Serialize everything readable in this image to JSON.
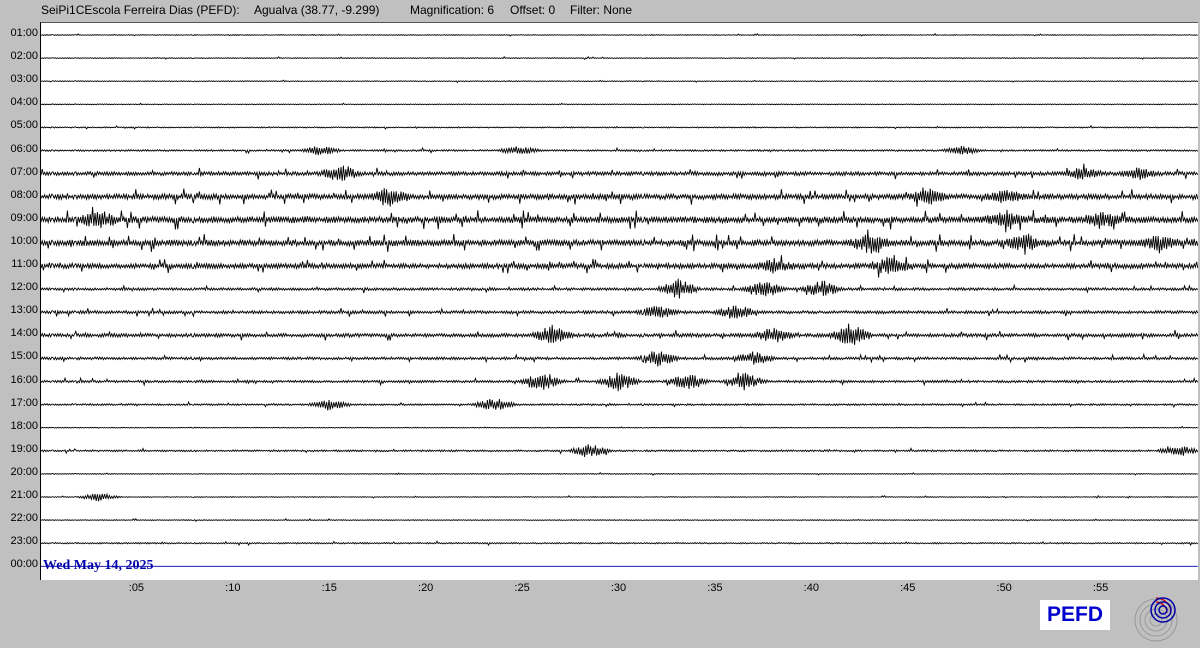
{
  "header": {
    "station": "SeiPi1CEscola Ferreira Dias (PEFD):",
    "location": "Agualva (38.77, -9.299)",
    "magnification": "Magnification: 6",
    "offset": "Offset: 0",
    "filter": "Filter: None"
  },
  "chart_data": {
    "type": "helicorder",
    "date_label": "Wed May 14, 2025",
    "hour_labels": [
      "01:00",
      "02:00",
      "03:00",
      "04:00",
      "05:00",
      "06:00",
      "07:00",
      "08:00",
      "09:00",
      "10:00",
      "11:00",
      "12:00",
      "13:00",
      "14:00",
      "15:00",
      "16:00",
      "17:00",
      "18:00",
      "19:00",
      "20:00",
      "21:00",
      "22:00",
      "23:00",
      "00:00"
    ],
    "minute_labels": [
      ":05",
      ":10",
      ":15",
      ":20",
      ":25",
      ":30",
      ":35",
      ":40",
      ":45",
      ":50",
      ":55"
    ],
    "x_range_minutes": [
      0,
      60
    ],
    "current_trace_color": "#0000aa",
    "trace_color": "#000000",
    "activity": [
      {
        "hour": "01:00",
        "level": 0.3
      },
      {
        "hour": "02:00",
        "level": 0.3
      },
      {
        "hour": "03:00",
        "level": 0.3
      },
      {
        "hour": "04:00",
        "level": 0.3
      },
      {
        "hour": "05:00",
        "level": 0.4
      },
      {
        "hour": "06:00",
        "level": 0.6,
        "bursts": [
          [
            14.5,
            4
          ],
          [
            24.8,
            3
          ],
          [
            47.8,
            3
          ]
        ]
      },
      {
        "hour": "07:00",
        "level": 1.3,
        "bursts": [
          [
            15.5,
            6
          ],
          [
            54,
            4
          ],
          [
            57,
            4
          ]
        ]
      },
      {
        "hour": "08:00",
        "level": 1.8,
        "bursts": [
          [
            18,
            5
          ],
          [
            46,
            5
          ],
          [
            50,
            4
          ]
        ]
      },
      {
        "hour": "09:00",
        "level": 2.2,
        "bursts": [
          [
            3,
            6
          ],
          [
            50,
            5
          ],
          [
            55,
            5
          ]
        ]
      },
      {
        "hour": "10:00",
        "level": 2.0,
        "bursts": [
          [
            43,
            7
          ],
          [
            51,
            6
          ],
          [
            58,
            5
          ]
        ]
      },
      {
        "hour": "11:00",
        "level": 1.7,
        "bursts": [
          [
            44,
            6
          ],
          [
            38,
            5
          ]
        ]
      },
      {
        "hour": "12:00",
        "level": 0.9,
        "bursts": [
          [
            33,
            7
          ],
          [
            37.5,
            6
          ],
          [
            40.5,
            6
          ]
        ]
      },
      {
        "hour": "13:00",
        "level": 1.0,
        "bursts": [
          [
            32,
            5
          ],
          [
            36,
            6
          ]
        ]
      },
      {
        "hour": "14:00",
        "level": 1.2,
        "bursts": [
          [
            26.5,
            7
          ],
          [
            42,
            8
          ],
          [
            38,
            5
          ]
        ]
      },
      {
        "hour": "15:00",
        "level": 0.9,
        "bursts": [
          [
            32,
            6
          ],
          [
            37,
            5
          ]
        ]
      },
      {
        "hour": "16:00",
        "level": 0.8,
        "bursts": [
          [
            26,
            7
          ],
          [
            30,
            7
          ],
          [
            33.5,
            6
          ],
          [
            36.5,
            6
          ]
        ]
      },
      {
        "hour": "17:00",
        "level": 0.6,
        "bursts": [
          [
            15,
            4
          ],
          [
            23.5,
            5
          ]
        ]
      },
      {
        "hour": "18:00",
        "level": 0.3
      },
      {
        "hour": "19:00",
        "level": 0.6,
        "bursts": [
          [
            28.5,
            5
          ],
          [
            59,
            4
          ]
        ]
      },
      {
        "hour": "20:00",
        "level": 0.3
      },
      {
        "hour": "21:00",
        "level": 0.3,
        "bursts": [
          [
            3,
            3
          ]
        ]
      },
      {
        "hour": "22:00",
        "level": 0.3
      },
      {
        "hour": "23:00",
        "level": 0.5
      },
      {
        "hour": "00:00",
        "level": 0
      }
    ]
  },
  "logo": {
    "text": "PEFD"
  },
  "colors": {
    "background": "#c0c0c0",
    "plot_bg": "#ffffff",
    "logo_text": "#0000cc"
  }
}
